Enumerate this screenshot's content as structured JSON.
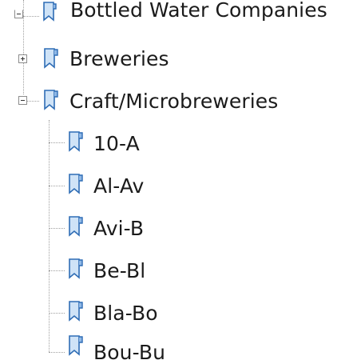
{
  "tree": {
    "items": [
      {
        "label": "Bottled Water Companies",
        "toggle": "minus-partial",
        "icon": "bookmark-folder-icon",
        "level": 0
      },
      {
        "label": "Breweries",
        "toggle": "plus",
        "icon": "bookmark-folder-icon",
        "level": 0
      },
      {
        "label": "Craft/Microbreweries",
        "toggle": "minus",
        "icon": "bookmark-folder-icon",
        "level": 0,
        "expanded": true,
        "children": [
          {
            "label": "10-A",
            "icon": "bookmark-icon"
          },
          {
            "label": "Al-Av",
            "icon": "bookmark-icon"
          },
          {
            "label": "Avi-B",
            "icon": "bookmark-icon"
          },
          {
            "label": "Be-Bl",
            "icon": "bookmark-icon"
          },
          {
            "label": "Bla-Bo",
            "icon": "bookmark-icon"
          },
          {
            "label": "Bou-Bu",
            "icon": "bookmark-icon"
          }
        ]
      }
    ]
  },
  "colors": {
    "icon_stroke": "#2f6db5",
    "icon_fill_light": "#cfe3f7",
    "icon_fill_mid": "#8fb8e6",
    "connector": "#a0a0a0",
    "text": "#1b1b1b"
  }
}
